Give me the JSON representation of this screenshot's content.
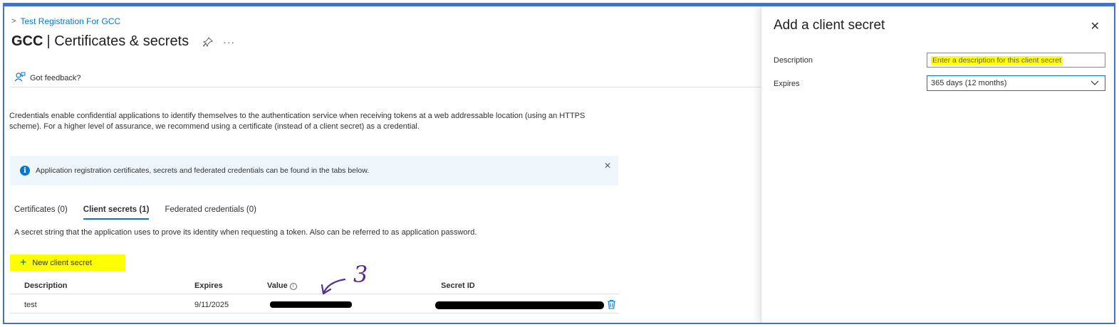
{
  "breadcrumb": {
    "item": "Test Registration For GCC"
  },
  "page": {
    "title_strong": "GCC",
    "title_rest": "| Certificates & secrets",
    "more": "···"
  },
  "toolbar": {
    "feedback_label": "Got feedback?"
  },
  "description": "Credentials enable confidential applications to identify themselves to the authentication service when receiving tokens at a web addressable location (using an HTTPS scheme). For a higher level of assurance, we recommend using a certificate (instead of a client secret) as a credential.",
  "infobar": {
    "text": "Application registration certificates, secrets and federated credentials can be found in the tabs below.",
    "close": "✕"
  },
  "tabs": [
    {
      "label": "Certificates (0)"
    },
    {
      "label": "Client secrets (1)"
    },
    {
      "label": "Federated credentials (0)"
    }
  ],
  "secrets": {
    "description": "A secret string that the application uses to prove its identity when requesting a token. Also can be referred to as application password.",
    "new_button": "New client secret",
    "columns": [
      "Description",
      "Expires",
      "Value",
      "Secret ID"
    ],
    "rows": [
      {
        "description": "test",
        "expires": "9/11/2025"
      }
    ]
  },
  "annotation": {
    "text": "3"
  },
  "panel": {
    "title": "Add a client secret",
    "close": "✕",
    "description_label": "Description",
    "description_placeholder": "Enter a description for this client secret",
    "expires_label": "Expires",
    "expires_value": "365 days (12 months)"
  },
  "colors": {
    "accent": "#0078d4",
    "highlight": "#ffff00",
    "frame": "#4472c4"
  }
}
